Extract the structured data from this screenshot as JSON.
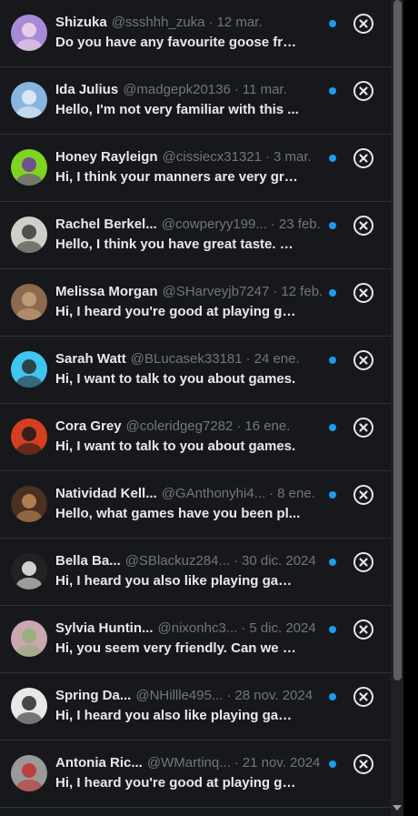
{
  "conversations": [
    {
      "name": "Shizuka",
      "handle": "@ssshhh_zuka",
      "date": "12 mar.",
      "preview": "Do you have any favourite goose fro...",
      "unread": true,
      "avatar_color": "#a78bd8",
      "avatar_accent": "#f3d9e8"
    },
    {
      "name": "Ida Julius",
      "handle": "@madgepk20136",
      "date": "11 mar.",
      "preview": "Hello, I'm not very familiar with this ...",
      "unread": true,
      "avatar_color": "#8ab4e0",
      "avatar_accent": "#e9eef5"
    },
    {
      "name": "Honey Rayleign",
      "handle": "@cissiecx31321",
      "date": "3 mar.",
      "preview": "Hi, I think your manners are very gra...",
      "unread": true,
      "avatar_color": "#7fd321",
      "avatar_accent": "#6a3aa0"
    },
    {
      "name": "Rachel Berkel...",
      "handle": "@cowperyy199...",
      "date": "23 feb.",
      "preview": "Hello, I think you have great taste. C...",
      "unread": true,
      "avatar_color": "#cfcfc9",
      "avatar_accent": "#3a3a36"
    },
    {
      "name": "Melissa Morgan",
      "handle": "@SHarveyjb7247",
      "date": "12 feb.",
      "preview": "Hi, I heard you're good at playing ga...",
      "unread": true,
      "avatar_color": "#8b6a4f",
      "avatar_accent": "#c9a27f"
    },
    {
      "name": "Sarah Watt",
      "handle": "@BLucasek33181",
      "date": "24 ene.",
      "preview": "Hi, I want to talk to you about games.",
      "unread": true,
      "avatar_color": "#3fc6f0",
      "avatar_accent": "#2c2c2c"
    },
    {
      "name": "Cora Grey",
      "handle": "@coleridgeg7282",
      "date": "16 ene.",
      "preview": "Hi, I want to talk to you about games.",
      "unread": true,
      "avatar_color": "#d4401f",
      "avatar_accent": "#1a1a1a"
    },
    {
      "name": "Natividad Kell...",
      "handle": "@GAnthonyhi4...",
      "date": "8 ene.",
      "preview": "Hello, what games have you been pl...",
      "unread": true,
      "avatar_color": "#4a3020",
      "avatar_accent": "#c48a5a"
    },
    {
      "name": "Bella Ba...",
      "handle": "@SBlackuz284...",
      "date": "30 dic. 2024",
      "preview": "Hi, I heard you also like playing gam...",
      "unread": true,
      "avatar_color": "#222222",
      "avatar_accent": "#eeeeee"
    },
    {
      "name": "Sylvia Huntin...",
      "handle": "@nixonhc3...",
      "date": "5 dic. 2024",
      "preview": "Hi, you seem very friendly. Can we b...",
      "unread": true,
      "avatar_color": "#c9a8b0",
      "avatar_accent": "#8fb07a"
    },
    {
      "name": "Spring Da...",
      "handle": "@NHillle495...",
      "date": "28 nov. 2024",
      "preview": "Hi, I heard you also like playing gam...",
      "unread": true,
      "avatar_color": "#e8e8e8",
      "avatar_accent": "#2a2a2a"
    },
    {
      "name": "Antonia Ric...",
      "handle": "@WMartinq...",
      "date": "21 nov. 2024",
      "preview": "Hi, I heard you're good at playing ga...",
      "unread": true,
      "avatar_color": "#9a9a9a",
      "avatar_accent": "#c23030"
    }
  ],
  "separator": "·",
  "icons": {
    "close": "close-circle-icon",
    "unread": "unread-dot-icon"
  },
  "colors": {
    "background": "#16181c",
    "text": "#e7e9ea",
    "muted": "#71767b",
    "accent": "#1d9bf0",
    "divider": "#2f3336"
  }
}
